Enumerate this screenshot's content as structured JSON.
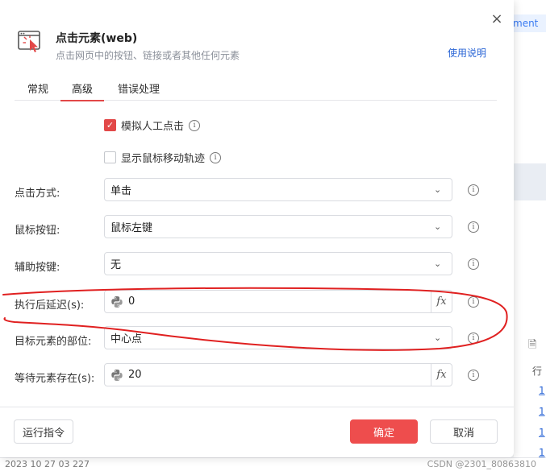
{
  "background": {
    "tag_text": "ment",
    "column_header": "行",
    "cell_value": "1",
    "status_left": "2023 10 27 03 227",
    "watermark": "CSDN @2301_80863810"
  },
  "dialog": {
    "title": "点击元素(web)",
    "subtitle": "点击网页中的按钮、链接或者其他任何元素",
    "help_link": "使用说明",
    "close": "×"
  },
  "tabs": [
    {
      "label": "常规",
      "active": false
    },
    {
      "label": "高级",
      "active": true
    },
    {
      "label": "错误处理",
      "active": false
    }
  ],
  "checkboxes": [
    {
      "label": "模拟人工点击",
      "checked": true
    },
    {
      "label": "显示鼠标移动轨迹",
      "checked": false
    }
  ],
  "fields": [
    {
      "label": "点击方式:",
      "value": "单击",
      "type": "select"
    },
    {
      "label": "鼠标按钮:",
      "value": "鼠标左键",
      "type": "select"
    },
    {
      "label": "辅助按键:",
      "value": "无",
      "type": "select"
    },
    {
      "label": "执行后延迟(s):",
      "value": "0",
      "type": "expression"
    },
    {
      "label": "目标元素的部位:",
      "value": "中心点",
      "type": "select"
    },
    {
      "label": "等待元素存在(s):",
      "value": "20",
      "type": "expression"
    }
  ],
  "fx_label": "fx",
  "buttons": {
    "run": "运行指令",
    "ok": "确定",
    "cancel": "取消"
  },
  "colors": {
    "accent": "#e24848",
    "primary_button": "#ee4d4d",
    "link": "#2b66d6",
    "annotation": "#e02020"
  }
}
